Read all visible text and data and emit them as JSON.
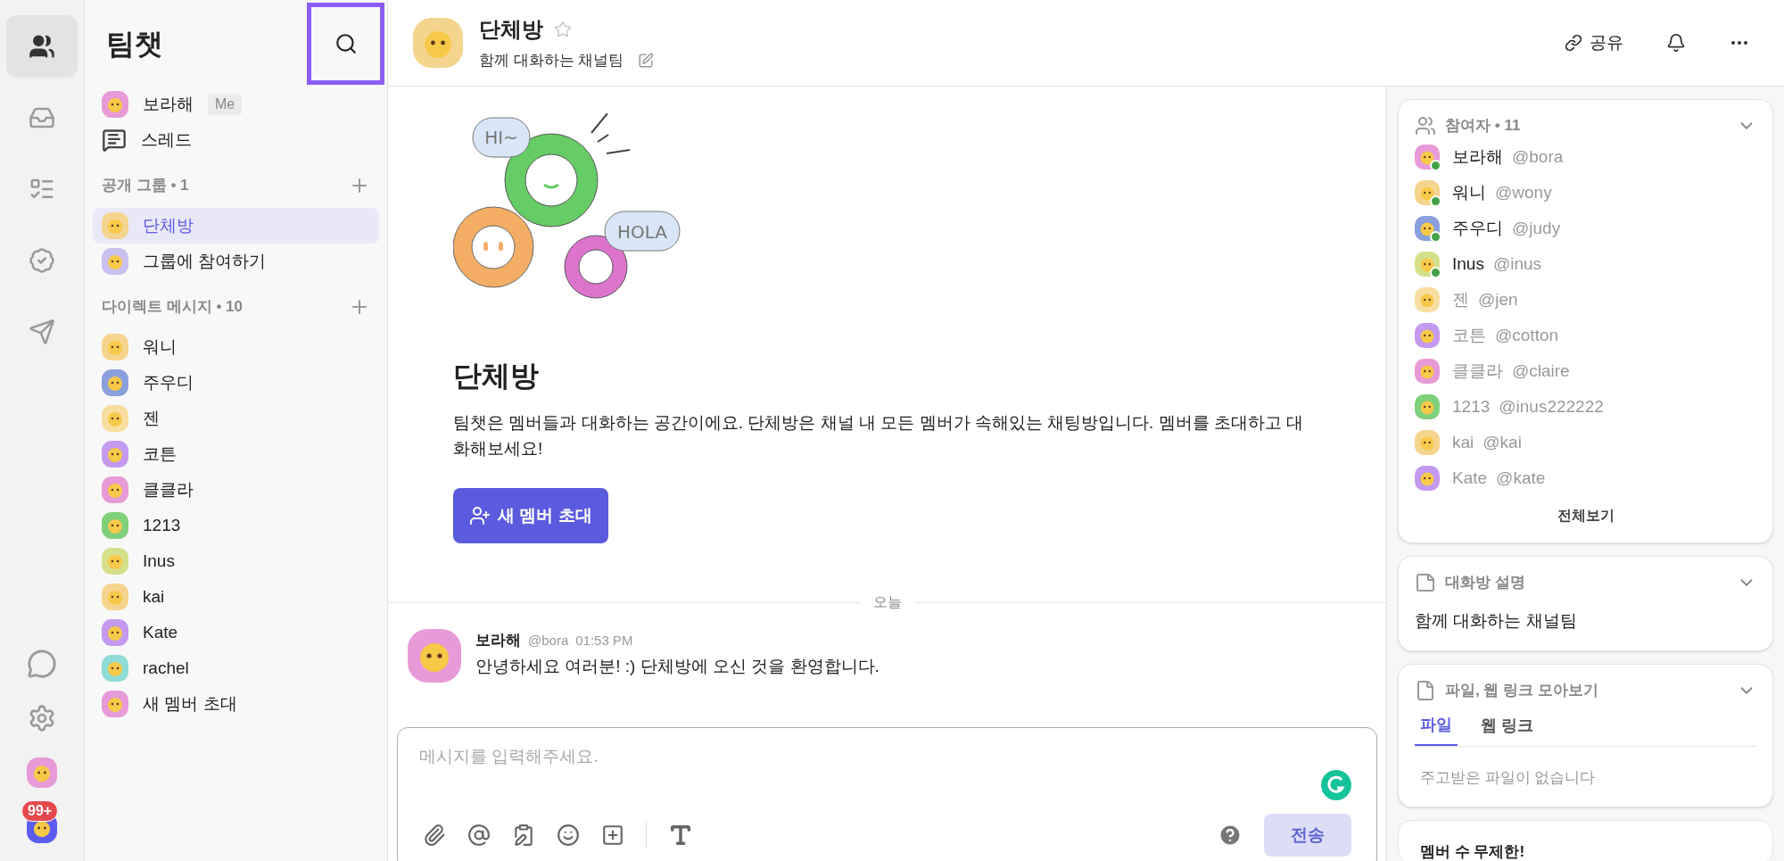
{
  "rail": {
    "items": [
      {
        "kind": "people",
        "selected": true
      },
      {
        "kind": "inbox",
        "selected": false
      },
      {
        "kind": "list",
        "selected": false
      },
      {
        "kind": "badge",
        "selected": false
      },
      {
        "kind": "send",
        "selected": false
      }
    ],
    "bottom": [
      {
        "kind": "chat"
      },
      {
        "kind": "settings"
      },
      {
        "kind": "avatar",
        "color": "#e79ad8"
      },
      {
        "kind": "avatar",
        "color": "#5b5bf0",
        "badge": "99+"
      }
    ]
  },
  "sidebar": {
    "title": "팀챗",
    "search": {
      "highlighted": true
    },
    "me": {
      "name": "보라해",
      "tag": "Me",
      "color": "#e79ad8"
    },
    "threads": "스레드",
    "sections": [
      {
        "title": "공개 그룹 • 1",
        "items": [
          {
            "name": "단체방",
            "color": "#f5d48e",
            "selected": true
          },
          {
            "name": "그룹에 참여하기",
            "color": "#c9c0f0",
            "selected": false
          }
        ]
      },
      {
        "title": "다이렉트 메시지 • 10",
        "items": [
          {
            "name": "워니",
            "color": "#f5d48e",
            "selected": false
          },
          {
            "name": "주우디",
            "color": "#8aa0dc",
            "selected": false
          },
          {
            "name": "젠",
            "color": "#f7dea0",
            "selected": false
          },
          {
            "name": "코튼",
            "color": "#c39af0",
            "selected": false
          },
          {
            "name": "클클라",
            "color": "#e79ad8",
            "selected": false
          },
          {
            "name": "1213",
            "color": "#7fd07a",
            "selected": false
          },
          {
            "name": "Inus",
            "color": "#d6e08a",
            "selected": false
          },
          {
            "name": "kai",
            "color": "#f5d48e",
            "selected": false
          },
          {
            "name": "Kate",
            "color": "#c39af0",
            "selected": false
          },
          {
            "name": "rachel",
            "color": "#8fdcd6",
            "selected": false
          },
          {
            "name": "새 멤버 초대",
            "color": "#e79ad8",
            "selected": false
          }
        ]
      }
    ]
  },
  "header": {
    "title": "단체방",
    "subtitle": "함께 대화하는 채널팀",
    "share": "공유",
    "starred": false
  },
  "intro": {
    "bubbles": [
      "HI~",
      "HOLA"
    ],
    "title": "단체방",
    "text": "팀챗은 멤버들과 대화하는 공간이에요. 단체방은 채널 내 모든 멤버가 속해있는 채팅방입니다. 멤버를 초대하고 대화해보세요!",
    "button": "새 멤버 초대"
  },
  "divider": "오늘",
  "messages": [
    {
      "name": "보라해",
      "handle": "@bora",
      "time": "01:53 PM",
      "text": "안녕하세요 여러분! :) 단체방에 오신 것을 환영합니다.",
      "color": "#e79ad8"
    }
  ],
  "composer": {
    "placeholder": "메시지를 입력해주세요.",
    "send": "전송",
    "send_disabled": true
  },
  "panel": {
    "participants": {
      "title": "참여자 • 11",
      "more": "전체보기",
      "items": [
        {
          "name": "보라해",
          "handle": "@bora",
          "online": true,
          "color": "#e79ad8"
        },
        {
          "name": "워니",
          "handle": "@wony",
          "online": true,
          "color": "#f5d48e"
        },
        {
          "name": "주우디",
          "handle": "@judy",
          "online": true,
          "color": "#8aa0dc"
        },
        {
          "name": "Inus",
          "handle": "@inus",
          "online": true,
          "color": "#d6e08a"
        },
        {
          "name": "젠",
          "handle": "@jen",
          "online": false,
          "color": "#f7dea0"
        },
        {
          "name": "코튼",
          "handle": "@cotton",
          "online": false,
          "color": "#c39af0"
        },
        {
          "name": "클클라",
          "handle": "@claire",
          "online": false,
          "color": "#e79ad8"
        },
        {
          "name": "1213",
          "handle": "@inus222222",
          "online": false,
          "color": "#7fd07a"
        },
        {
          "name": "kai",
          "handle": "@kai",
          "online": false,
          "color": "#f5d48e"
        },
        {
          "name": "Kate",
          "handle": "@kate",
          "online": false,
          "color": "#c39af0"
        }
      ]
    },
    "description": {
      "title": "대화방 설명",
      "text": "함께 대화하는 채널팀"
    },
    "files": {
      "title": "파일, 웹 링크 모아보기",
      "tabs": [
        {
          "label": "파일",
          "selected": true
        },
        {
          "label": "웹 링크",
          "selected": false
        }
      ],
      "empty": "주고받은 파일이 없습니다"
    },
    "promo": {
      "title": "멤버 수 무제한!"
    }
  }
}
